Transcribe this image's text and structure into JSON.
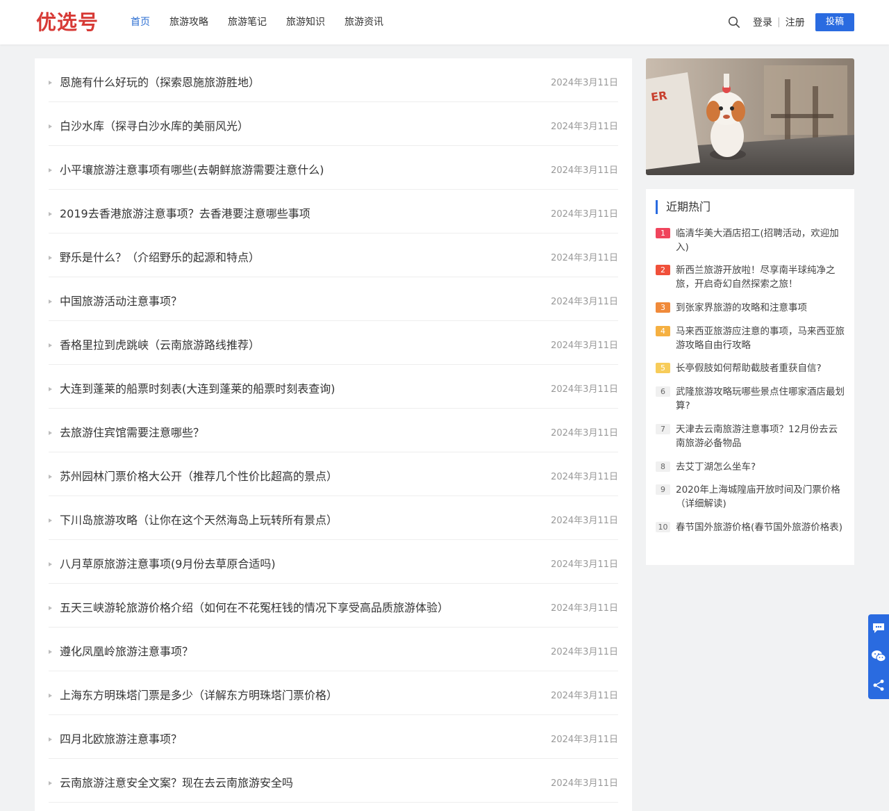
{
  "header": {
    "logo": "优选号",
    "nav": [
      "首页",
      "旅游攻略",
      "旅游笔记",
      "旅游知识",
      "旅游资讯"
    ],
    "active_nav": "首页",
    "login": "登录",
    "register": "注册",
    "post": "投稿",
    "brand_color": "#d73a36",
    "accent_color": "#2a6be0"
  },
  "articles": [
    {
      "title": "恩施有什么好玩的（探索恩施旅游胜地）",
      "date": "2024年3月11日"
    },
    {
      "title": "白沙水库（探寻白沙水库的美丽风光）",
      "date": "2024年3月11日"
    },
    {
      "title": "小平壤旅游注意事项有哪些(去朝鲜旅游需要注意什么)",
      "date": "2024年3月11日"
    },
    {
      "title": "2019去香港旅游注意事项？去香港要注意哪些事项",
      "date": "2024年3月11日"
    },
    {
      "title": "野乐是什么？（介绍野乐的起源和特点）",
      "date": "2024年3月11日"
    },
    {
      "title": "中国旅游活动注意事项？",
      "date": "2024年3月11日"
    },
    {
      "title": "香格里拉到虎跳峡（云南旅游路线推荐）",
      "date": "2024年3月11日"
    },
    {
      "title": "大连到蓬莱的船票时刻表(大连到蓬莱的船票时刻表查询)",
      "date": "2024年3月11日"
    },
    {
      "title": "去旅游住宾馆需要注意哪些？",
      "date": "2024年3月11日"
    },
    {
      "title": "苏州园林门票价格大公开（推荐几个性价比超高的景点）",
      "date": "2024年3月11日"
    },
    {
      "title": "下川岛旅游攻略（让你在这个天然海岛上玩转所有景点）",
      "date": "2024年3月11日"
    },
    {
      "title": "八月草原旅游注意事项(9月份去草原合适吗)",
      "date": "2024年3月11日"
    },
    {
      "title": "五天三峡游轮旅游价格介绍（如何在不花冤枉钱的情况下享受高品质旅游体验）",
      "date": "2024年3月11日"
    },
    {
      "title": "遵化凤凰岭旅游注意事项？",
      "date": "2024年3月11日"
    },
    {
      "title": "上海东方明珠塔门票是多少（详解东方明珠塔门票价格）",
      "date": "2024年3月11日"
    },
    {
      "title": "四月北欧旅游注意事项？",
      "date": "2024年3月11日"
    },
    {
      "title": "云南旅游注意安全文案？现在去云南旅游安全吗",
      "date": "2024年3月11日"
    }
  ],
  "sidebar": {
    "hot_title": "近期热门",
    "hot_items": [
      {
        "rank": "1",
        "text": "临清华美大酒店招工(招聘活动，欢迎加入)",
        "color": "#f0445c"
      },
      {
        "rank": "2",
        "text": "新西兰旅游开放啦！尽享南半球纯净之旅，开启奇幻自然探索之旅！",
        "color": "#f0503a"
      },
      {
        "rank": "3",
        "text": "到张家界旅游的攻略和注意事项",
        "color": "#f08a3a"
      },
      {
        "rank": "4",
        "text": "马来西亚旅游应注意的事项，马来西亚旅游攻略自由行攻略",
        "color": "#f5b041"
      },
      {
        "rank": "5",
        "text": "长亭假肢如何帮助截肢者重获自信?",
        "color": "#f7cc5a"
      },
      {
        "rank": "6",
        "text": "武隆旅游攻略玩哪些景点住哪家酒店最划算?",
        "color": "#f0f0f0"
      },
      {
        "rank": "7",
        "text": "天津去云南旅游注意事项？12月份去云南旅游必备物品",
        "color": "#f0f0f0"
      },
      {
        "rank": "8",
        "text": "去艾丁湖怎么坐车?",
        "color": "#f0f0f0"
      },
      {
        "rank": "9",
        "text": "2020年上海城隍庙开放时间及门票价格（详细解读)",
        "color": "#f0f0f0"
      },
      {
        "rank": "10",
        "text": "春节国外旅游价格(春节国外旅游价格表)",
        "color": "#f0f0f0"
      }
    ]
  },
  "icons": {
    "search": "search-icon",
    "float": [
      "comment-icon",
      "wechat-icon",
      "share-icon"
    ]
  }
}
